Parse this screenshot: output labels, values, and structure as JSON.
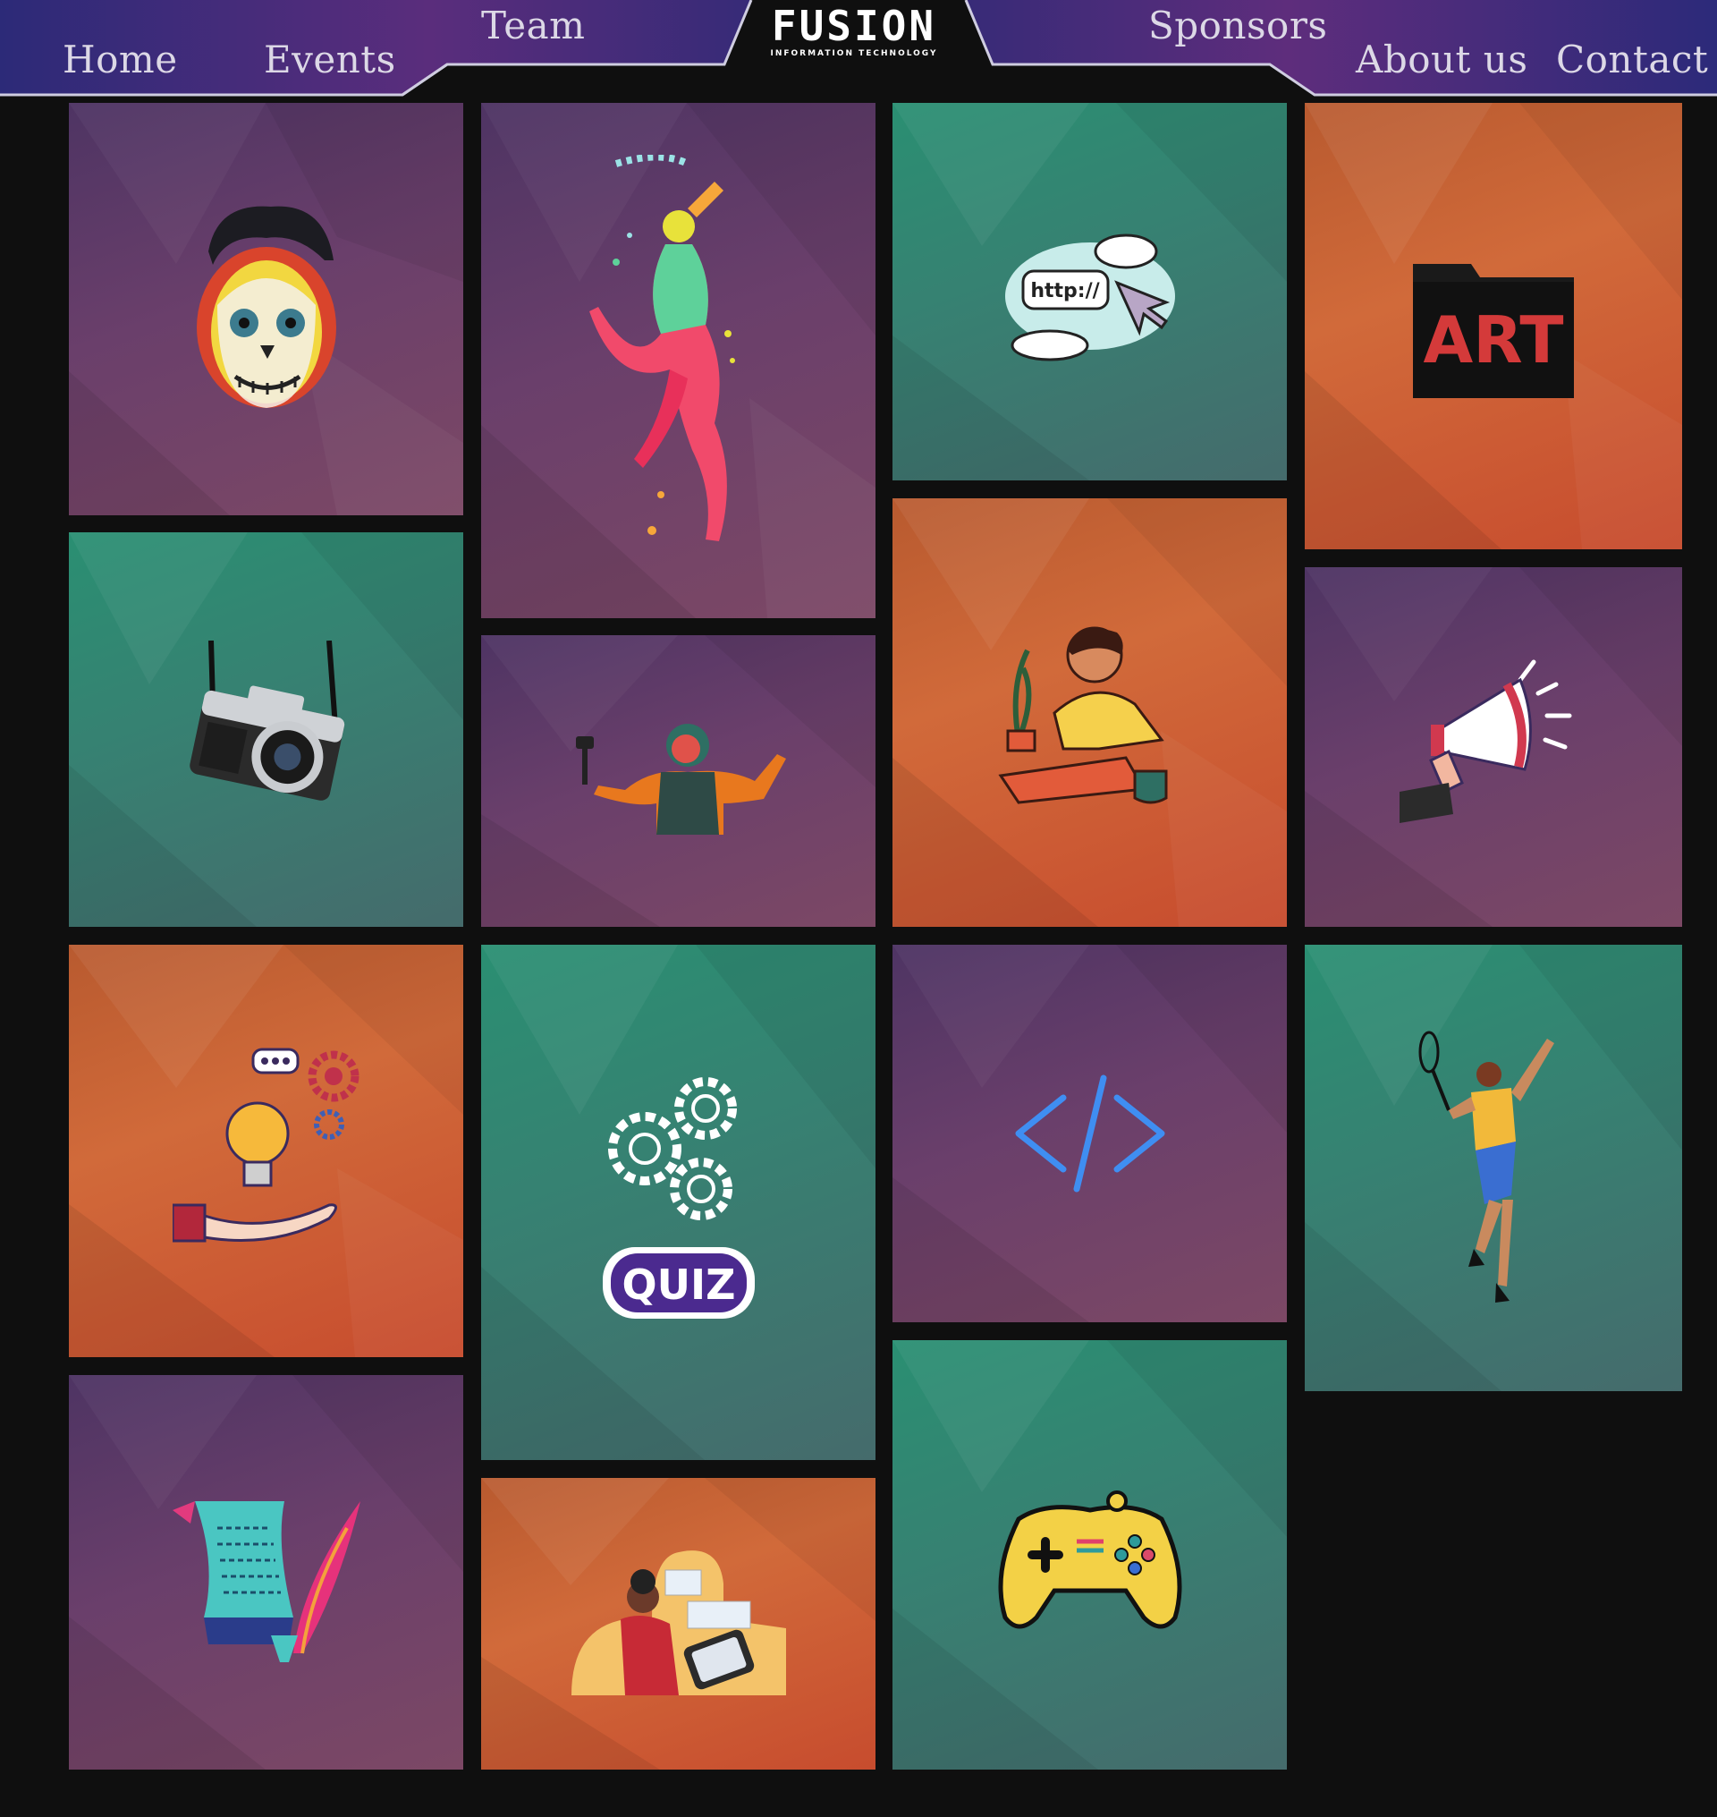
{
  "nav": {
    "home": "Home",
    "events": "Events",
    "team": "Team",
    "sponsors": "Sponsors",
    "about": "About us",
    "contact": "Contact"
  },
  "logo": {
    "word": "FUSION",
    "subtitle": "INFORMATION TECHNOLOGY"
  },
  "quiz_label": "QUIZ",
  "url_label": "http://",
  "art_label": "ART",
  "colors": {
    "purple": "#5e3a66",
    "green": "#2f8a70",
    "orange": "#cc6335",
    "background": "#0f0f0f"
  },
  "tiles": [
    {
      "id": "face-paint",
      "color": "purple",
      "icon": "sugar-skull-face-icon"
    },
    {
      "id": "dance",
      "color": "purple",
      "icon": "colorful-dancer-icon"
    },
    {
      "id": "web",
      "color": "green",
      "icon": "web-url-cloud-icon"
    },
    {
      "id": "art",
      "color": "orange",
      "icon": "art-folder-icon"
    },
    {
      "id": "photography",
      "color": "green",
      "icon": "camera-icon"
    },
    {
      "id": "vlogging",
      "color": "purple",
      "icon": "vlogger-icon"
    },
    {
      "id": "drawing",
      "color": "orange",
      "icon": "digital-drawing-icon"
    },
    {
      "id": "promotion",
      "color": "purple",
      "icon": "megaphone-icon"
    },
    {
      "id": "ideas",
      "color": "orange",
      "icon": "idea-bulb-gears-icon"
    },
    {
      "id": "quiz",
      "color": "green",
      "icon": "quiz-gears-icon"
    },
    {
      "id": "coding",
      "color": "purple",
      "icon": "code-brackets-icon"
    },
    {
      "id": "badminton",
      "color": "green",
      "icon": "badminton-player-icon"
    },
    {
      "id": "writing",
      "color": "purple",
      "icon": "scroll-quill-icon"
    },
    {
      "id": "design",
      "color": "orange",
      "icon": "designer-tablet-icon"
    },
    {
      "id": "gaming",
      "color": "green",
      "icon": "gamepad-icon"
    }
  ]
}
